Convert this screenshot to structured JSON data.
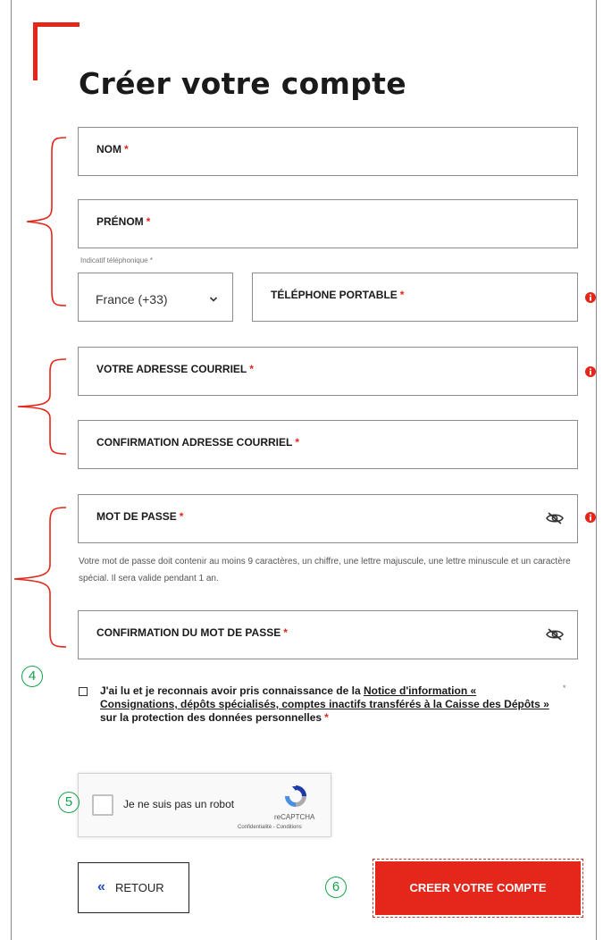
{
  "page": {
    "title": "Créer votre compte"
  },
  "form": {
    "nom_label": "NOM",
    "prenom_label": "PRÉNOM",
    "indicatif_label": "Indicatif téléphonique *",
    "country_value": "France (+33)",
    "telephone_label": "TÉLÉPHONE PORTABLE",
    "email_label": "VOTRE ADRESSE COURRIEL",
    "email_confirm_label": "CONFIRMATION ADRESSE COURRIEL",
    "password_label": "MOT DE PASSE",
    "password_help": "Votre mot de passe doit contenir au moins 9 caractères, un chiffre, une lettre majuscule, une lettre minuscule et un caractère spécial. Il sera valide pendant 1 an.",
    "password_confirm_label": "CONFIRMATION DU MOT DE PASSE",
    "required_mark": "*"
  },
  "consent": {
    "text_before": "J'ai lu et je reconnais avoir pris connaissance de la ",
    "link_text": "Notice d'information « Consignations, dépôts spécialisés, comptes inactifs transférés à la Caisse des Dépôts »",
    "text_after": " sur la protection des données personnelles",
    "required_mark": "*",
    "side_mark": "*"
  },
  "captcha": {
    "label": "Je ne suis pas un robot",
    "brand": "reCAPTCHA",
    "terms": "Confidentialité - Conditions"
  },
  "buttons": {
    "back_icon": "«",
    "back_label": "RETOUR",
    "create_label": "CREER VOTRE COMPTE"
  },
  "annotations": {
    "four": "4",
    "five": "5",
    "six": "6"
  },
  "colors": {
    "accent": "#e4261b",
    "annotation": "#16a34a",
    "back_arrow": "#1d4ec9"
  }
}
